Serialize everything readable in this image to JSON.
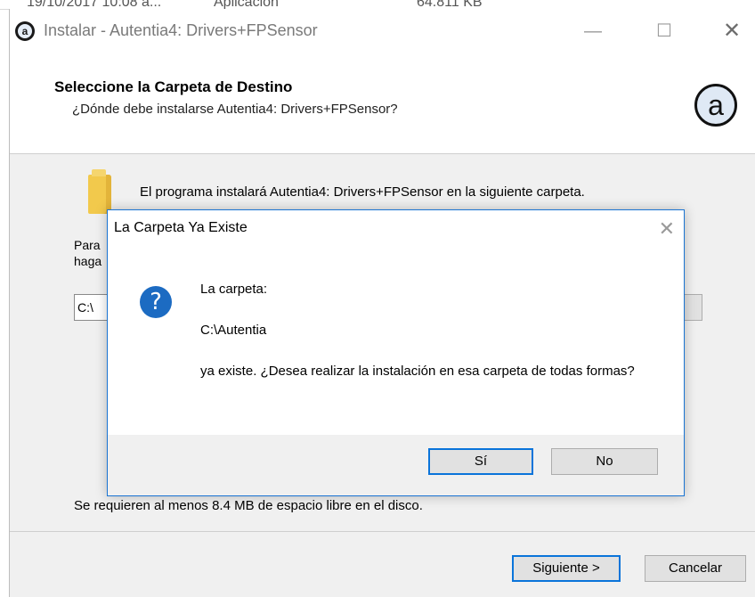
{
  "background_row": {
    "date": "19/10/2017 10:08 a...",
    "type": "Aplicación",
    "size": "64.811 KB"
  },
  "window": {
    "title": "Instalar - Autentia4: Drivers+FPSensor",
    "icon_letter": "a",
    "minimize_glyph": "—",
    "maximize_glyph": "☐",
    "close_glyph": "✕"
  },
  "header": {
    "title": "Seleccione la Carpeta de Destino",
    "subtitle": "¿Dónde debe instalarse Autentia4: Drivers+FPSensor?",
    "logo_letter": "a"
  },
  "content": {
    "install_text": "El programa instalará Autentia4: Drivers+FPSensor en la siguiente carpeta.",
    "para_line1": "Para",
    "para_line2": "haga",
    "path_value": "C:\\",
    "space_text": "Se requieren al menos 8.4 MB de espacio libre en el disco."
  },
  "footer": {
    "next_label": "Siguiente >",
    "cancel_label": "Cancelar"
  },
  "dialog": {
    "title": "La Carpeta Ya Existe",
    "close_glyph": "✕",
    "icon_glyph": "?",
    "line1": "La carpeta:",
    "path": "C:\\Autentia",
    "line3": "ya existe. ¿Desea realizar la instalación en esa carpeta de todas formas?",
    "yes_label": "Sí",
    "no_label": "No"
  }
}
